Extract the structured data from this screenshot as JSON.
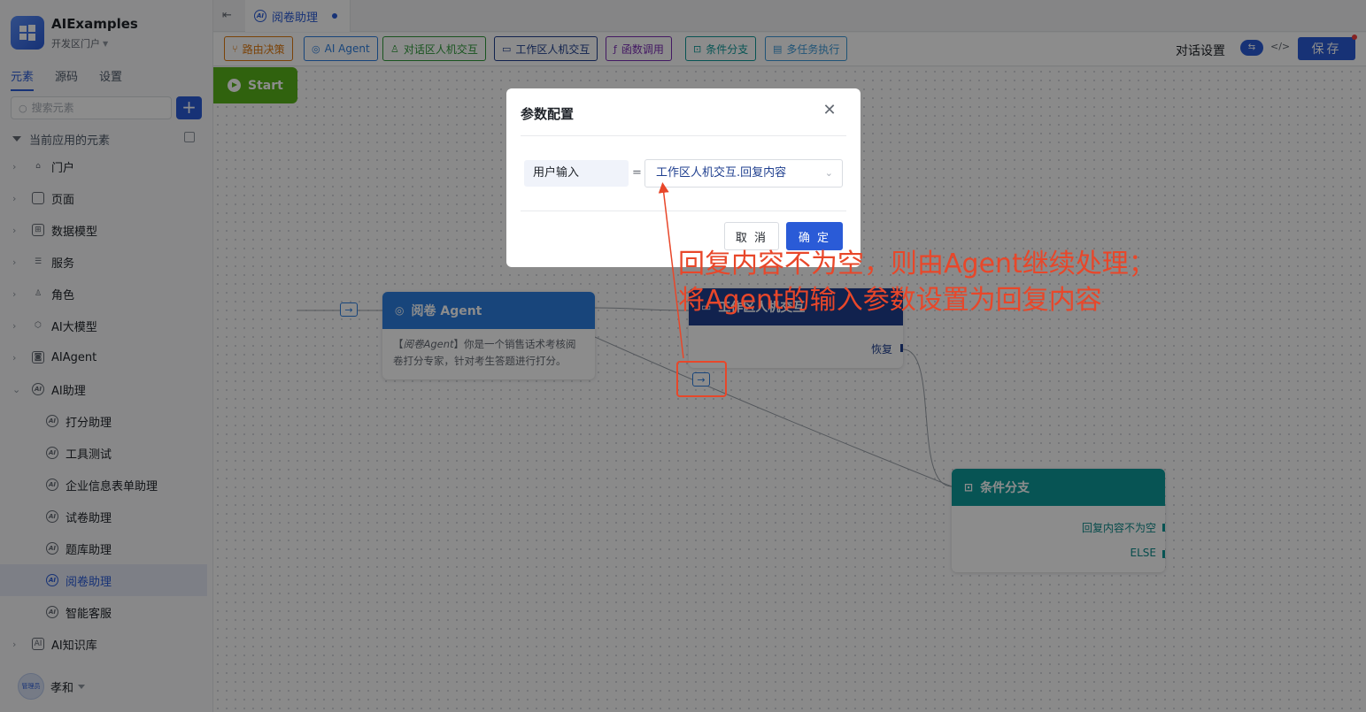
{
  "app": {
    "name": "AIExamples",
    "portal": "开发区门户"
  },
  "sidebar": {
    "tabs": [
      "元素",
      "源码",
      "设置"
    ],
    "search_placeholder": "搜索元素",
    "add_label": "+",
    "root_label": "当前应用的元素",
    "items": [
      {
        "label": "门户",
        "icon": "home-icon"
      },
      {
        "label": "页面",
        "icon": "page-icon"
      },
      {
        "label": "数据模型",
        "icon": "table-icon"
      },
      {
        "label": "服务",
        "icon": "database-icon"
      },
      {
        "label": "角色",
        "icon": "roles-icon"
      },
      {
        "label": "AI大模型",
        "icon": "cube-icon"
      },
      {
        "label": "AIAgent",
        "icon": "robot-icon"
      },
      {
        "label": "AI助理",
        "icon": "ai-icon"
      },
      {
        "label": "打分助理",
        "icon": "ai-icon"
      },
      {
        "label": "工具测试",
        "icon": "ai-icon"
      },
      {
        "label": "企业信息表单助理",
        "icon": "ai-icon"
      },
      {
        "label": "试卷助理",
        "icon": "ai-icon"
      },
      {
        "label": "题库助理",
        "icon": "ai-icon"
      },
      {
        "label": "阅卷助理",
        "icon": "ai-icon"
      },
      {
        "label": "智能客服",
        "icon": "ai-icon"
      },
      {
        "label": "AI知识库",
        "icon": "book-icon"
      }
    ],
    "user": {
      "name": "孝和",
      "avatar_text": "管理员"
    }
  },
  "tab_strip": {
    "active_tab": "阅卷助理"
  },
  "toolbar": {
    "tools": [
      {
        "label": "路由决策",
        "color": "#e07a10"
      },
      {
        "label": "AI Agent",
        "color": "#2d7fe0"
      },
      {
        "label": "对话区人机交互",
        "color": "#2f9a3a"
      },
      {
        "label": "工作区人机交互",
        "color": "#1f3f8f"
      },
      {
        "label": "函数调用",
        "color": "#7a2fb5"
      },
      {
        "label": "条件分支",
        "color": "#0e9a9a"
      },
      {
        "label": "多任务执行",
        "color": "#3b9ad9"
      }
    ],
    "dialog_settings": "对话设置",
    "save_label": "保存"
  },
  "canvas": {
    "start_label": "Start",
    "agent_node": {
      "title": "阅卷 Agent",
      "desc_prefix": "【",
      "desc_name": "阅卷Agent",
      "desc_rest": "】你是一个销售话术考核阅卷打分专家，针对考生答题进行打分。"
    },
    "work_node": {
      "title": "工作区人机交互",
      "port_label": "恢复"
    },
    "cond_node": {
      "title": "条件分支",
      "branch_1": "回复内容不为空",
      "branch_2": "ELSE"
    }
  },
  "modal": {
    "title": "参数配置",
    "param_name": "用户输入",
    "equals": "=",
    "param_value": "工作区人机交互.回复内容",
    "cancel_label": "取 消",
    "ok_label": "确 定"
  },
  "annotation": {
    "line1": "回复内容不为空，则由Agent继续处理；",
    "line2": "将Agent的输入参数设置为回复内容",
    "color": "#e8472a"
  }
}
